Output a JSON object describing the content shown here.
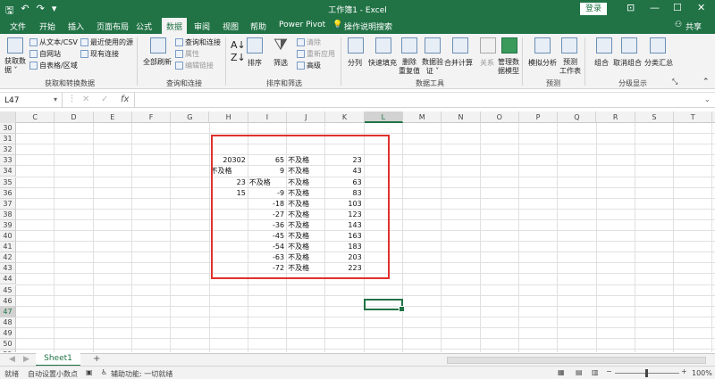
{
  "titlebar": {
    "title": "工作簿1  -  Excel",
    "login": "登录",
    "autosave_icon": "save-icon",
    "undo_icon": "undo-icon",
    "redo_icon": "redo-icon",
    "restore_icon": "ribbon-display-icon",
    "minimize": "—",
    "maximize": "☐",
    "close": "✕"
  },
  "tabs": [
    "文件",
    "开始",
    "插入",
    "页面布局",
    "公式",
    "数据",
    "审阅",
    "视图",
    "帮助",
    "Power Pivot",
    "操作说明搜索",
    "共享"
  ],
  "ribbon": {
    "get_data": "获取数\n据 ˅",
    "from_text": "从文本/CSV",
    "from_web": "自网站",
    "from_table": "自表格/区域",
    "recent_sources": "最近使用的源",
    "existing_conn": "现有连接",
    "group1": "获取和转换数据",
    "refresh_all": "全部刷新",
    "queries": "查询和连接",
    "properties": "属性",
    "edit_links": "编辑链接",
    "group2": "查询和连接",
    "sort": "排序",
    "filter": "筛选",
    "clear": "清除",
    "reapply": "重新应用",
    "advanced": "高级",
    "group3": "排序和筛选",
    "text_to_cols": "分列",
    "flash_fill": "快速填充",
    "remove_dup": "删除\n重复值",
    "validate": "数据验\n证 ˅",
    "consolidate": "合并计算",
    "relations": "关系",
    "data_model": "管理数\n据模型",
    "group4": "数据工具",
    "whatif": "模拟分析",
    "forecast": "预测\n工作表",
    "group5": "预测",
    "group_btn": "组合",
    "ungroup": "取消组合",
    "subtotal": "分类汇总",
    "group6": "分级显示"
  },
  "formula_bar": {
    "namebox": "L47",
    "fx": "fx",
    "value": ""
  },
  "columns": [
    "C",
    "D",
    "E",
    "F",
    "G",
    "H",
    "I",
    "J",
    "K",
    "L",
    "M",
    "N",
    "O",
    "P",
    "Q",
    "R",
    "S",
    "T"
  ],
  "rows": [
    "30",
    "31",
    "32",
    "33",
    "34",
    "35",
    "36",
    "37",
    "38",
    "39",
    "40",
    "41",
    "42",
    "43",
    "44",
    "45",
    "46",
    "47",
    "48",
    "49",
    "50",
    "51"
  ],
  "cells": [
    {
      "row": "33",
      "col": "H",
      "v": "20302",
      "a": "r"
    },
    {
      "row": "33",
      "col": "I",
      "v": "65",
      "a": "r"
    },
    {
      "row": "33",
      "col": "J",
      "v": "不及格",
      "a": "l"
    },
    {
      "row": "33",
      "col": "K",
      "v": "23",
      "a": "r"
    },
    {
      "row": "34",
      "col": "H",
      "v": "不及格",
      "a": "l"
    },
    {
      "row": "34",
      "col": "I",
      "v": "9",
      "a": "r"
    },
    {
      "row": "34",
      "col": "J",
      "v": "不及格",
      "a": "l"
    },
    {
      "row": "34",
      "col": "K",
      "v": "43",
      "a": "r"
    },
    {
      "row": "35",
      "col": "H",
      "v": "23",
      "a": "r"
    },
    {
      "row": "35",
      "col": "I",
      "v": "不及格",
      "a": "l"
    },
    {
      "row": "35",
      "col": "J",
      "v": "不及格",
      "a": "l"
    },
    {
      "row": "35",
      "col": "K",
      "v": "63",
      "a": "r"
    },
    {
      "row": "36",
      "col": "H",
      "v": "15",
      "a": "r"
    },
    {
      "row": "36",
      "col": "I",
      "v": "-9",
      "a": "r"
    },
    {
      "row": "36",
      "col": "J",
      "v": "不及格",
      "a": "l"
    },
    {
      "row": "36",
      "col": "K",
      "v": "83",
      "a": "r"
    },
    {
      "row": "37",
      "col": "I",
      "v": "-18",
      "a": "r"
    },
    {
      "row": "37",
      "col": "J",
      "v": "不及格",
      "a": "l"
    },
    {
      "row": "37",
      "col": "K",
      "v": "103",
      "a": "r"
    },
    {
      "row": "38",
      "col": "I",
      "v": "-27",
      "a": "r"
    },
    {
      "row": "38",
      "col": "J",
      "v": "不及格",
      "a": "l"
    },
    {
      "row": "38",
      "col": "K",
      "v": "123",
      "a": "r"
    },
    {
      "row": "39",
      "col": "I",
      "v": "-36",
      "a": "r"
    },
    {
      "row": "39",
      "col": "J",
      "v": "不及格",
      "a": "l"
    },
    {
      "row": "39",
      "col": "K",
      "v": "143",
      "a": "r"
    },
    {
      "row": "40",
      "col": "I",
      "v": "-45",
      "a": "r"
    },
    {
      "row": "40",
      "col": "J",
      "v": "不及格",
      "a": "l"
    },
    {
      "row": "40",
      "col": "K",
      "v": "163",
      "a": "r"
    },
    {
      "row": "41",
      "col": "I",
      "v": "-54",
      "a": "r"
    },
    {
      "row": "41",
      "col": "J",
      "v": "不及格",
      "a": "l"
    },
    {
      "row": "41",
      "col": "K",
      "v": "183",
      "a": "r"
    },
    {
      "row": "42",
      "col": "I",
      "v": "-63",
      "a": "r"
    },
    {
      "row": "42",
      "col": "J",
      "v": "不及格",
      "a": "l"
    },
    {
      "row": "42",
      "col": "K",
      "v": "203",
      "a": "r"
    },
    {
      "row": "43",
      "col": "I",
      "v": "-72",
      "a": "r"
    },
    {
      "row": "43",
      "col": "J",
      "v": "不及格",
      "a": "l"
    },
    {
      "row": "43",
      "col": "K",
      "v": "223",
      "a": "r"
    }
  ],
  "sheet": {
    "name": "Sheet1",
    "add": "+"
  },
  "status": {
    "ready": "就绪",
    "auto_decimal": "自动设置小数点",
    "accessibility": "辅助功能: 一切就绪",
    "zoom": "100%"
  },
  "colors": {
    "excel_green": "#217346",
    "highlight_red": "#e0312d"
  }
}
